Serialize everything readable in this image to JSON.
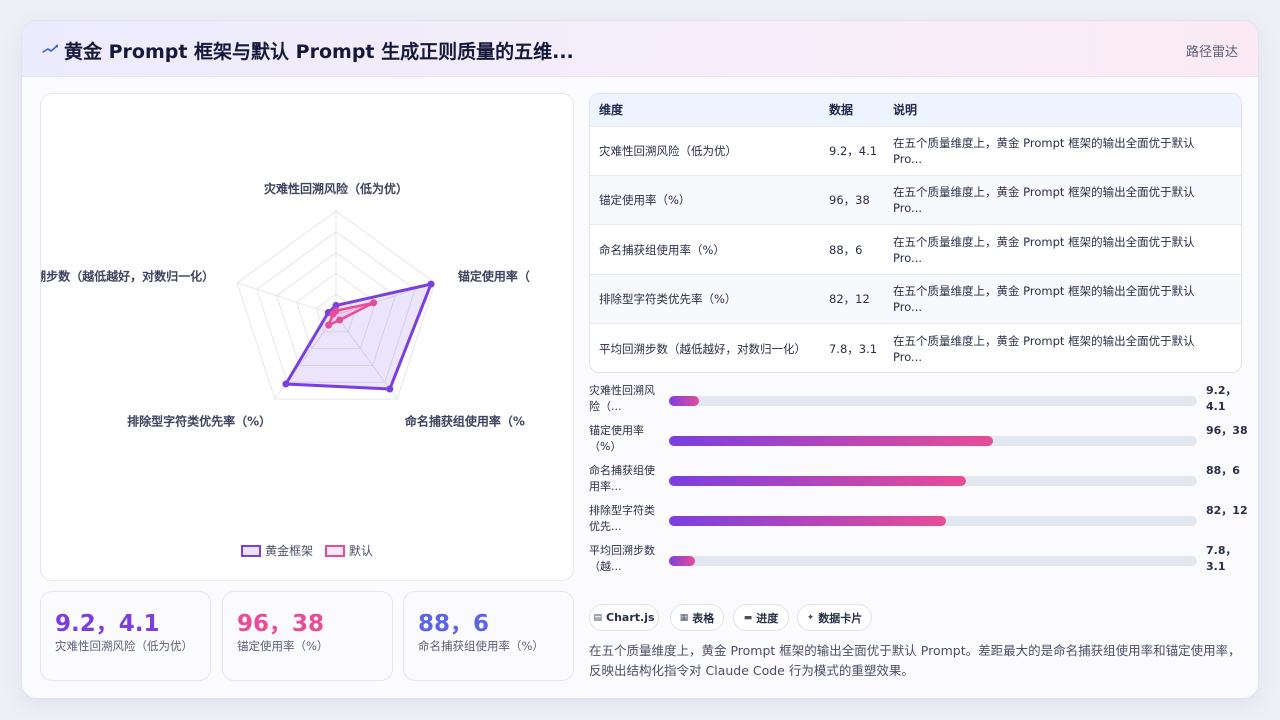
{
  "header": {
    "title": "黄金 Prompt 框架与默认 Prompt 生成正则质量的五维...",
    "nav_link": "路径雷达"
  },
  "chart_data": {
    "type": "radar",
    "title": "黄金 Prompt 框架与默认 Prompt 生成正则质量的五维...",
    "axes": [
      "灾难性回溯风险（低为优）",
      "锚定使用率（%）",
      "命名捕获组使用率（%）",
      "排除型字符类优先率（%）",
      "平均回溯步数（越低越好，对数归一化）"
    ],
    "axis_labels_display": [
      "灾难性回溯风险（低为优）",
      "锚定使用率（",
      "命名捕获组使用率（%",
      "排除型字符类优先率（%）",
      "均回溯步数（越低越好，对数归一化）"
    ],
    "series": [
      {
        "name": "黄金框架",
        "color": "#7b3fe0",
        "values": [
          9.2,
          96,
          88,
          82,
          7.8
        ]
      },
      {
        "name": "默认",
        "color": "#e84c96",
        "values": [
          4.1,
          38,
          6,
          12,
          3.1
        ]
      }
    ],
    "rlim": [
      0,
      100
    ],
    "legend_position": "bottom"
  },
  "kpis": [
    {
      "value": "9.2，4.1",
      "label": "灾难性回溯风险（低为优）",
      "color": "#7b3fe0"
    },
    {
      "value": "96，38",
      "label": "锚定使用率（%）",
      "color": "#e84c96"
    },
    {
      "value": "88，6",
      "label": "命名捕获组使用率（%）",
      "color": "#5b63e8"
    }
  ],
  "table": {
    "headers": [
      "维度",
      "数据",
      "说明"
    ],
    "rows": [
      {
        "dim": "灾难性回溯风险（低为优）",
        "data": "9.2，4.1",
        "note": "在五个质量维度上，黄金 Prompt 框架的输出全面优于默认 Pro..."
      },
      {
        "dim": "锚定使用率（%）",
        "data": "96，38",
        "note": "在五个质量维度上，黄金 Prompt 框架的输出全面优于默认 Pro..."
      },
      {
        "dim": "命名捕获组使用率（%）",
        "data": "88，6",
        "note": "在五个质量维度上，黄金 Prompt 框架的输出全面优于默认 Pro..."
      },
      {
        "dim": "排除型字符类优先率（%）",
        "data": "82，12",
        "note": "在五个质量维度上，黄金 Prompt 框架的输出全面优于默认 Pro..."
      },
      {
        "dim": "平均回溯步数（越低越好，对数归一化）",
        "data": "7.8，3.1",
        "note": "在五个质量维度上，黄金 Prompt 框架的输出全面优于默认 Pro..."
      }
    ]
  },
  "progress": [
    {
      "label": "灾难性回溯风险（...",
      "value": "9.2，4.1",
      "fill": 0.056
    },
    {
      "label": "锚定使用率（%）",
      "value": "96，38",
      "fill": 0.614
    },
    {
      "label": "命名捕获组使用率...",
      "value": "88，6",
      "fill": 0.563
    },
    {
      "label": "排除型字符类优先...",
      "value": "82，12",
      "fill": 0.525
    },
    {
      "label": "平均回溯步数（越...",
      "value": "7.8，3.1",
      "fill": 0.05
    }
  ],
  "tags": [
    {
      "icon": "chart-icon",
      "glyph": "▤",
      "label": "Chart.js"
    },
    {
      "icon": "table-icon",
      "glyph": "▦",
      "label": "表格"
    },
    {
      "icon": "progress-icon",
      "glyph": "▬",
      "label": "进度"
    },
    {
      "icon": "datacard-icon",
      "glyph": "✦",
      "label": "数据卡片"
    }
  ],
  "summary": "在五个质量维度上，黄金 Prompt 框架的输出全面优于默认 Prompt。差距最大的是命名捕获组使用率和锚定使用率，反映出结构化指令对 Claude Code 行为模式的重塑效果。"
}
